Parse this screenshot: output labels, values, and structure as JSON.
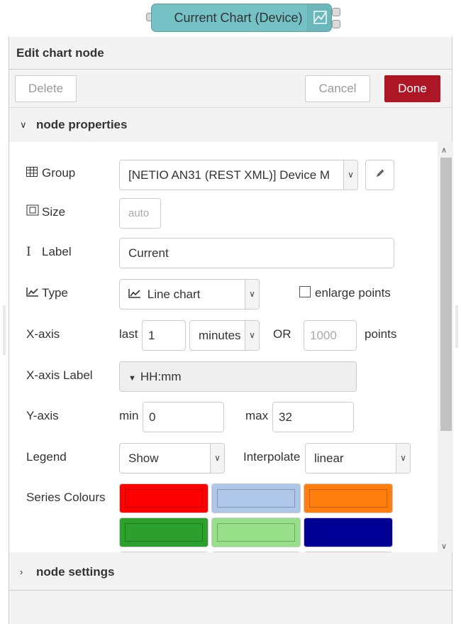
{
  "node": {
    "label": "Current Chart (Device)",
    "icon": "line-chart-icon",
    "colors": {
      "body": "#74c1c6"
    }
  },
  "editor": {
    "title": "Edit chart node",
    "delete_label": "Delete",
    "cancel_label": "Cancel",
    "done_label": "Done",
    "done_color": "#ad1625"
  },
  "sections": {
    "node_properties": "node properties",
    "node_settings": "node settings"
  },
  "form": {
    "group": {
      "label": "Group",
      "value": "[NETIO AN31 (REST XML)] Device M",
      "icon": "table-icon"
    },
    "size": {
      "label": "Size",
      "value": "auto",
      "icon": "size-icon"
    },
    "label": {
      "label": "Label",
      "value": "Current",
      "icon": "text-cursor-icon"
    },
    "type": {
      "label": "Type",
      "value": "Line chart",
      "icon": "line-chart-icon",
      "enlarge_points_label": "enlarge points"
    },
    "xaxis": {
      "label": "X-axis",
      "last_label": "last",
      "last_value": "1",
      "unit_value": "minutes",
      "or_label": "OR",
      "points_placeholder": "1000",
      "points_label": "points"
    },
    "xaxis_label": {
      "label": "X-axis Label",
      "value": "HH:mm"
    },
    "yaxis": {
      "label": "Y-axis",
      "min_label": "min",
      "min_value": "0",
      "max_label": "max",
      "max_value": "32"
    },
    "legend": {
      "label": "Legend",
      "value": "Show",
      "interpolate_label": "Interpolate",
      "interpolate_value": "linear"
    },
    "series_colours": {
      "label": "Series Colours",
      "colors": [
        "#ff0000",
        "#aec7e8",
        "#ff7f0e",
        "#2ca02c",
        "#98df8a",
        "#000096",
        "#ff9896",
        "#9467bd",
        "#c5b0d5"
      ]
    }
  }
}
